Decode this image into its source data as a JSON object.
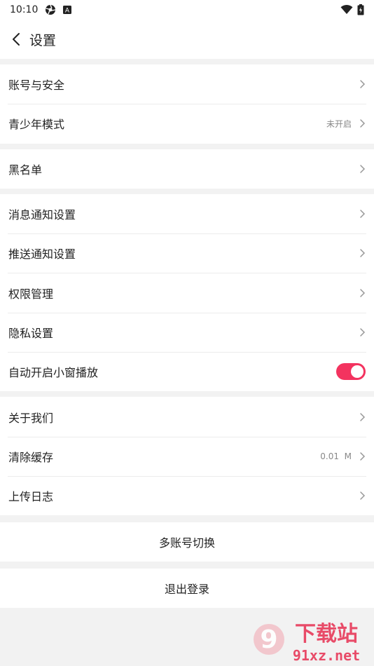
{
  "status_bar": {
    "time": "10:10",
    "badge": "A"
  },
  "header": {
    "title": "设置"
  },
  "groups": [
    {
      "items": [
        {
          "label": "账号与安全",
          "value": ""
        },
        {
          "label": "青少年模式",
          "value": "未开启"
        }
      ]
    },
    {
      "items": [
        {
          "label": "黑名单",
          "value": ""
        }
      ]
    },
    {
      "items": [
        {
          "label": "消息通知设置",
          "value": ""
        },
        {
          "label": "推送通知设置",
          "value": ""
        },
        {
          "label": "权限管理",
          "value": ""
        },
        {
          "label": "隐私设置",
          "value": ""
        },
        {
          "label": "自动开启小窗播放",
          "toggle": true
        }
      ]
    },
    {
      "items": [
        {
          "label": "关于我们",
          "value": ""
        },
        {
          "label": "清除缓存",
          "value": "0.01  M"
        },
        {
          "label": "上传日志",
          "value": ""
        }
      ]
    }
  ],
  "buttons": {
    "switch_account": "多账号切换",
    "logout": "退出登录"
  },
  "watermark": {
    "text_top": "下载站",
    "text_bottom": "91xz.net",
    "logo_number": "9"
  },
  "colors": {
    "accent": "#f3335f",
    "background": "#f2f2f2"
  }
}
